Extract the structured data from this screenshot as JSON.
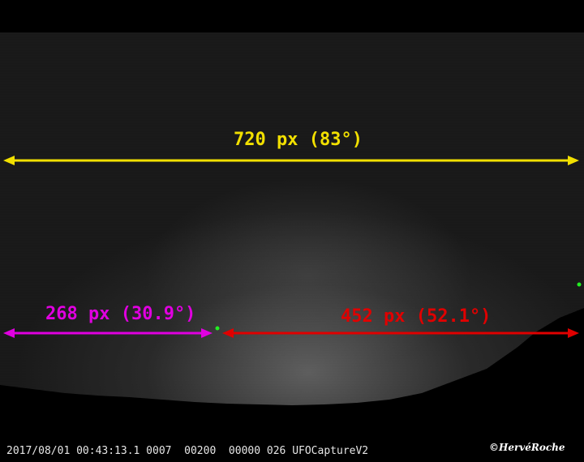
{
  "measurements": {
    "full": {
      "text": "720 px (83°)",
      "color": "#f2e000"
    },
    "left": {
      "text": "268 px (30.9°)",
      "color": "#e000e0"
    },
    "right": {
      "text": "452 px (52.1°)",
      "color": "#e00000"
    }
  },
  "footer": {
    "timestamp": "2017/08/01 00:43:13.1 0007  00200  00000 026 UFOCaptureV2",
    "credit": "©HervéRoche"
  },
  "markers": {
    "color": "#22ee22"
  }
}
